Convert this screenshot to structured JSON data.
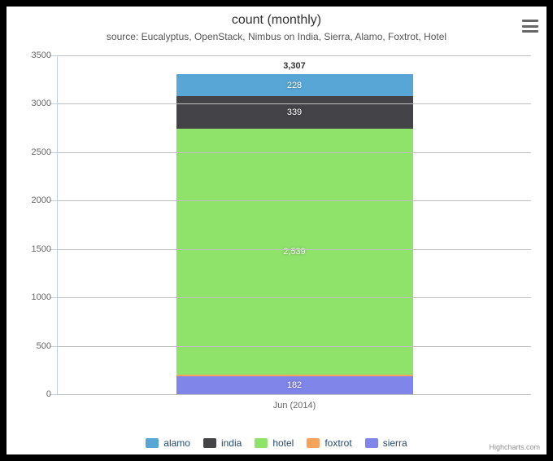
{
  "chart_data": {
    "type": "bar",
    "stacked": true,
    "title": "count (monthly)",
    "subtitle": "source: Eucalyptus, OpenStack, Nimbus on India, Sierra, Alamo, Foxtrot, Hotel",
    "categories": [
      "Jun (2014)"
    ],
    "series": [
      {
        "name": "alamo",
        "color": "#58a6d6",
        "values": [
          228
        ]
      },
      {
        "name": "india",
        "color": "#434348",
        "values": [
          339
        ]
      },
      {
        "name": "hotel",
        "color": "#8fe36b",
        "values": [
          2539
        ]
      },
      {
        "name": "foxtrot",
        "color": "#f7a35c",
        "values": [
          19
        ]
      },
      {
        "name": "sierra",
        "color": "#8085e9",
        "values": [
          182
        ]
      }
    ],
    "y_ticks": [
      0,
      500,
      1000,
      1500,
      2000,
      2500,
      3000,
      3500
    ],
    "ylim": [
      0,
      3500
    ],
    "totals": [
      "3,307"
    ],
    "credit": "Highcharts.com"
  }
}
